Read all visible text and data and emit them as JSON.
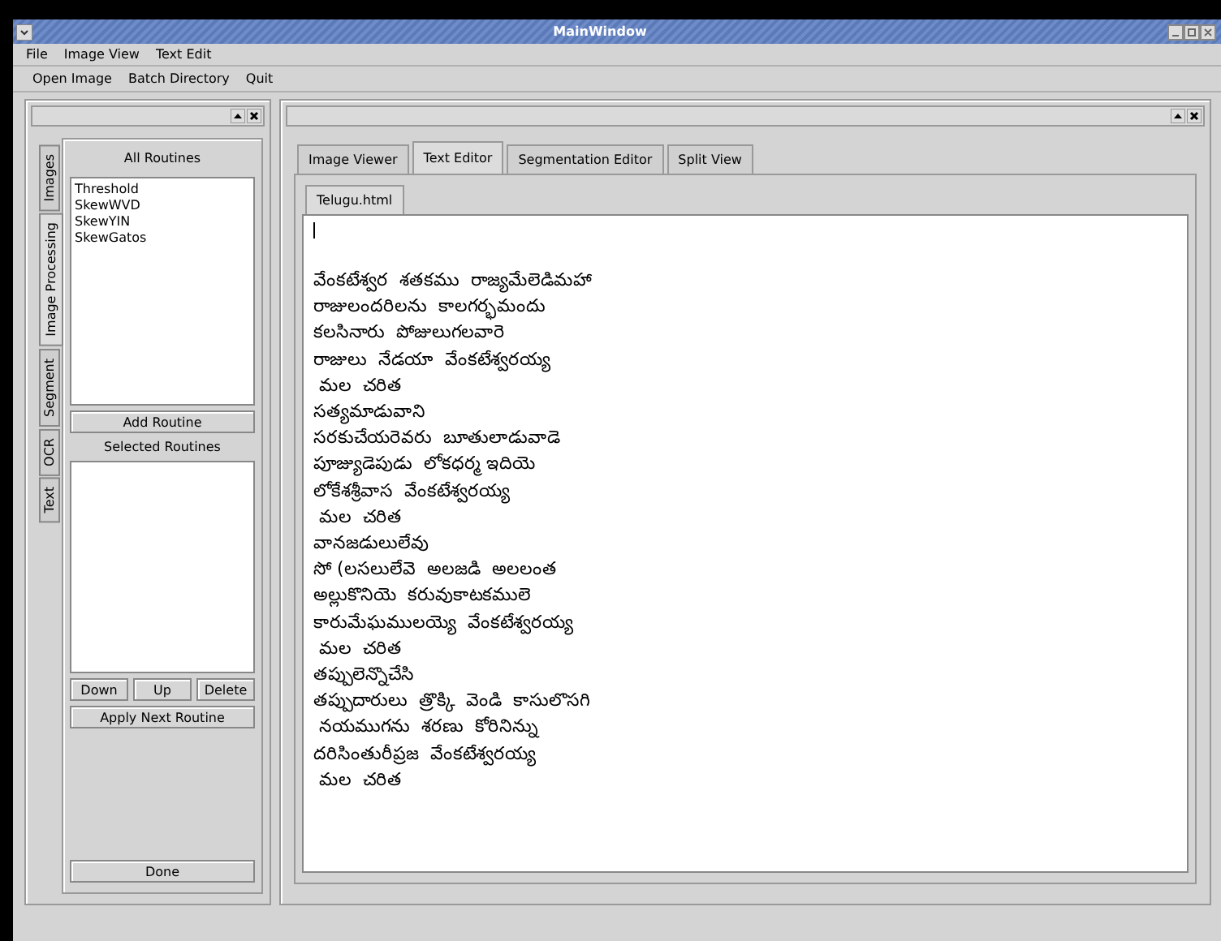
{
  "window": {
    "title": "MainWindow"
  },
  "menu": [
    "File",
    "Image View",
    "Text Edit"
  ],
  "toolbar": [
    "Open Image",
    "Batch Directory",
    "Quit"
  ],
  "left_dock": {
    "side_tabs": [
      {
        "label": "Images",
        "selected": false
      },
      {
        "label": "Image Processing",
        "selected": true
      },
      {
        "label": "Segment",
        "selected": false
      },
      {
        "label": "OCR",
        "selected": false
      },
      {
        "label": "Text",
        "selected": false
      }
    ],
    "all_routines_label": "All Routines",
    "routines": [
      "Threshold",
      "SkewWVD",
      "SkewYIN",
      "SkewGatos"
    ],
    "add_button": "Add Routine",
    "selected_routines_label": "Selected Routines",
    "order_buttons": [
      "Down",
      "Up",
      "Delete"
    ],
    "apply_button": "Apply Next Routine",
    "done_button": "Done"
  },
  "main_tabs": [
    {
      "label": "Image Viewer",
      "selected": false
    },
    {
      "label": "Text Editor",
      "selected": true
    },
    {
      "label": "Segmentation Editor",
      "selected": false
    },
    {
      "label": "Split View",
      "selected": false
    }
  ],
  "document_tabs": [
    {
      "label": "Telugu.html",
      "selected": true
    }
  ],
  "editor_lines": [
    "వేంకటేశ్వర  శతకము  రాజ్యమేలెడిమహా",
    "రాజులందరిలను  కాలగర్భమందు",
    "కలసినారు  పోజులుగలవారె",
    "రాజులు  నేడయా  వేంకటేశ్వరయ్య",
    " మల  చరిత",
    "సత్యమాడువాని",
    "సరకుచేయరెవరు  బూతులాడువాడె",
    "పూజ్యుడెపుడు  లోకధర్మ ఇదియె",
    "లోకేశశ్రీవాస  వేంకటేశ్వరయ్య",
    " మల  చరిత",
    "వానజడులులేవు",
    "సో (లసలులేవె  అలజడి  అలలంత",
    "అల్లుకొనియె  కరువుకాటకములె",
    "కారుమేఘములయ్యె  వేంకటేశ్వరయ్య",
    " మల  చరిత",
    "తప్పులెన్నొచేసి",
    "తప్పుదారులు  త్రొక్కి  వెండి  కాసులొసగి",
    " నయముగను  శరణు  కోరినిన్ను",
    "దరిసింతురీప్రజ  వేంకటేశ్వరయ్య",
    " మల  చరిత"
  ]
}
